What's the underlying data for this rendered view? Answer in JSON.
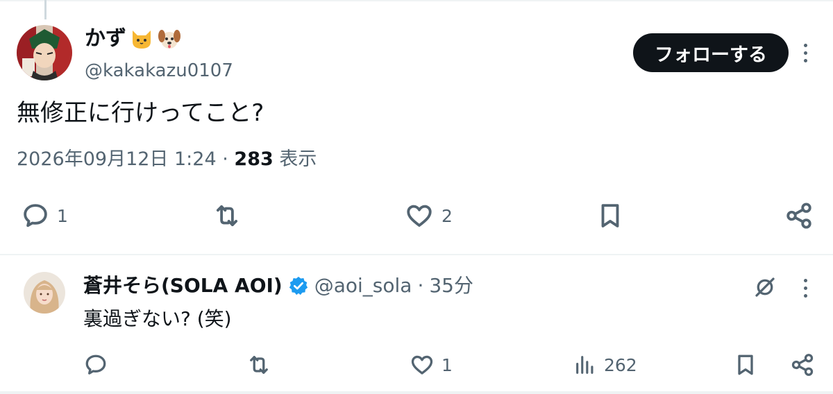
{
  "post": {
    "author_name": "かず",
    "author_emoji_1": "cat-face-emoji",
    "author_emoji_2": "dog-face-emoji",
    "author_handle": "@kakakazu0107",
    "follow_label": "フォローする",
    "text": "無修正に行けってこと?",
    "timestamp": "2026年09月12日 1:24",
    "separator": "·",
    "views_count": "283",
    "views_label": "表示",
    "actions": {
      "reply_count": "1",
      "retweet_count": "",
      "like_count": "2"
    }
  },
  "reply": {
    "author_name": "蒼井そら(SOLA AOI)",
    "author_handle": "@aoi_sola",
    "separator": "·",
    "time_ago": "35分",
    "text": "裏過ぎない? (笑)",
    "actions": {
      "reply_count": "",
      "retweet_count": "",
      "like_count": "1",
      "views_count": "262"
    }
  },
  "colors": {
    "text_primary": "#0f1419",
    "text_secondary": "#536471",
    "follow_bg": "#0f1419",
    "verified_blue": "#1d9bf0",
    "divider": "#eff3f4"
  }
}
